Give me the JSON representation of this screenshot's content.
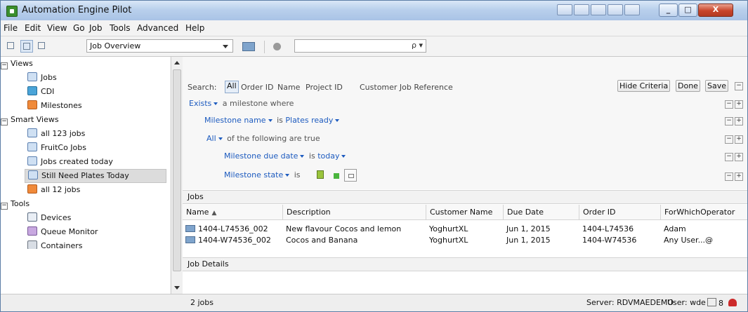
{
  "window": {
    "title": "Automation Engine Pilot",
    "close_label": "X"
  },
  "menu": [
    "File",
    "Edit",
    "View",
    "Go",
    "Job",
    "Tools",
    "Advanced",
    "Help"
  ],
  "toolbar": {
    "view_select": "Job Overview",
    "search_value": "",
    "search_glyph": "ρ ▾"
  },
  "sidebar": {
    "sections": [
      "Views",
      "Smart Views",
      "Tools"
    ],
    "views": [
      "Jobs",
      "CDI",
      "Milestones"
    ],
    "smart_views": [
      "all 123 jobs",
      "FruitCo Jobs",
      "Jobs created today",
      "Still Need Plates Today",
      "all 12 jobs"
    ],
    "tools": [
      "Devices",
      "Queue Monitor",
      "Containers"
    ],
    "selected": "Still Need Plates Today"
  },
  "criteria": {
    "search_label": "Search:",
    "search_fields": [
      "All",
      "Order ID",
      "Name",
      "Project ID",
      "Customer Job Reference"
    ],
    "buttons": [
      "Hide Criteria",
      "Done",
      "Save"
    ],
    "rule1_op": "Exists",
    "rule1_rest": "a milestone where",
    "rule2_field": "Milestone name",
    "rule2_is": "is",
    "rule2_value": "Plates ready",
    "rule3_op": "All",
    "rule3_rest": "of the following are true",
    "rule4_field": "Milestone due date",
    "rule4_is": "is",
    "rule4_value": "today",
    "rule5_field": "Milestone state",
    "rule5_is": "is"
  },
  "jobs": {
    "section_title": "Jobs",
    "columns": [
      "Name",
      "Description",
      "Customer Name",
      "Due Date",
      "Order ID",
      "ForWhichOperator"
    ],
    "sort_glyph": "▲",
    "rows": [
      [
        "1404-L74536_002",
        "New flavour Cocos and lemon",
        "YoghurtXL",
        "Jun 1, 2015",
        "1404-L74536",
        "Adam"
      ],
      [
        "1404-W74536_002",
        "Cocos and Banana",
        "YoghurtXL",
        "Jun 1, 2015",
        "1404-W74536",
        "Any User...@"
      ]
    ]
  },
  "job_details": {
    "title": "Job Details"
  },
  "status": {
    "count": "2 jobs",
    "server": "Server: RDVMAEDEMO",
    "user": "User: wde",
    "messages": "8"
  },
  "colors": {
    "accent": "#1d5bbf",
    "titlebar": "#b9d0ec",
    "close": "#c8452b"
  }
}
